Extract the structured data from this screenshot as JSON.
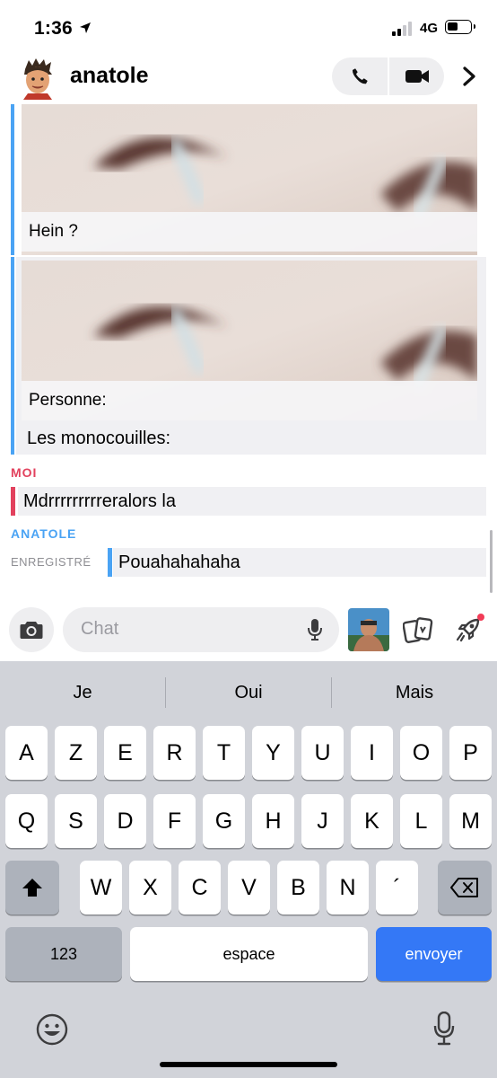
{
  "status_bar": {
    "time": "1:36",
    "network": "4G",
    "location_icon": "location-arrow-icon",
    "signal_icon": "signal-bars-icon",
    "battery_icon": "battery-icon"
  },
  "header": {
    "contact_name": "anatole",
    "avatar": "bitmoji-avatar",
    "buttons": [
      "phone-icon",
      "video-camera-icon",
      "chevron-right-icon"
    ]
  },
  "messages": {
    "media_captions": [
      "Hein ?",
      "Personne:"
    ],
    "text_below_media": "Les monocouilles:",
    "me_label": "MOI",
    "me_message": "Mdrrrrrrrrreralors la",
    "contact_label": "ANATOLE",
    "saved_label": "ENREGISTRÉ",
    "contact_message": "Pouahahahaha"
  },
  "composer": {
    "placeholder": "Chat",
    "icons": [
      "camera-icon",
      "microphone-icon",
      "memories-thumbnail",
      "cards-icon",
      "rocket-icon"
    ]
  },
  "keyboard": {
    "suggestions": [
      "Je",
      "Oui",
      "Mais"
    ],
    "row1": [
      "A",
      "Z",
      "E",
      "R",
      "T",
      "Y",
      "U",
      "I",
      "O",
      "P"
    ],
    "row2": [
      "Q",
      "S",
      "D",
      "F",
      "G",
      "H",
      "J",
      "K",
      "L",
      "M"
    ],
    "row3": [
      "W",
      "X",
      "C",
      "V",
      "B",
      "N",
      "´"
    ],
    "numbers_key": "123",
    "space_key": "espace",
    "send_key": "envoyer",
    "colors": {
      "send": "#3478f6",
      "accent_blue": "#4aa3f4",
      "accent_red": "#e2425e"
    }
  }
}
